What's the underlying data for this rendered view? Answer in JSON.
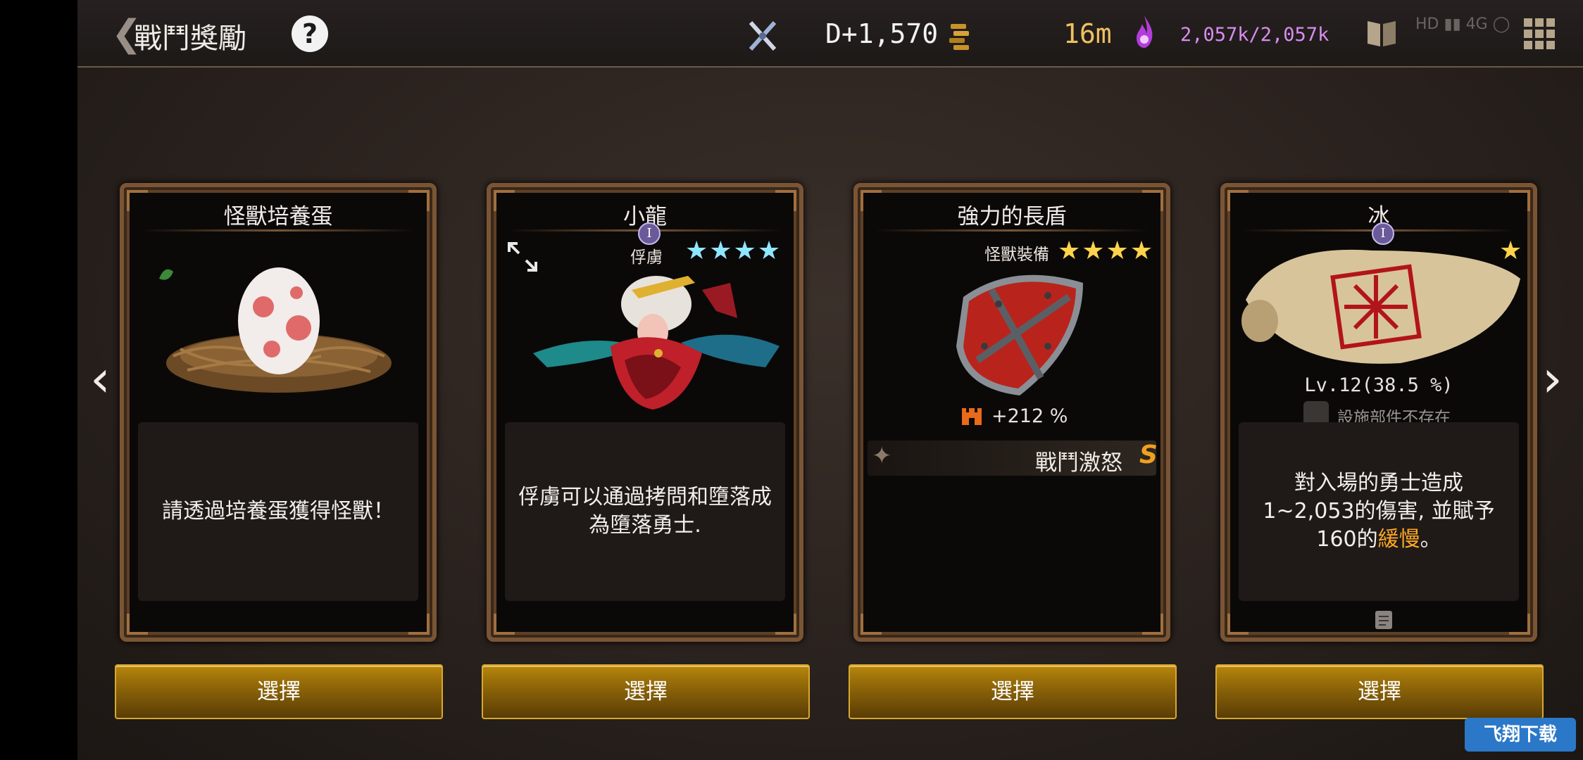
{
  "header": {
    "screen_title": "戰鬥獎勵",
    "help_label": "?",
    "day_counter": "D+1,570",
    "timer": "16m",
    "mana": "2,057k/2,057k"
  },
  "nav": {
    "prev_label": "‹",
    "next_label": "›"
  },
  "cards": [
    {
      "title": "怪獸培養蛋",
      "description": "請透過培養蛋獲得怪獸！",
      "select_label": "選擇"
    },
    {
      "title": "小龍",
      "rank": "I",
      "tag": "俘虜",
      "stars": "★★★★",
      "star_count": 4,
      "description": "俘虜可以通過拷問和墮落成為墮落勇士.",
      "select_label": "選擇"
    },
    {
      "title": "強力的長盾",
      "tag": "怪獸裝備",
      "stars": "★★★★",
      "star_count": 4,
      "stat": "+212 %",
      "skill_name": "戰鬥激怒",
      "skill_grade": "S",
      "select_label": "選擇"
    },
    {
      "title": "冰",
      "rank": "I",
      "stars": "★",
      "star_count": 1,
      "level": "Lv.12(38.5 %)",
      "facility_status": "設施部件不存在",
      "description_main": "對入場的勇士造成1~2,053的傷害, 並賦予160的",
      "description_highlight": "緩慢",
      "description_end": "。",
      "select_label": "選擇"
    }
  ],
  "watermark": "飞翔下载",
  "colors": {
    "gold_button": "#8a6208",
    "card_border": "#7a5535",
    "highlight_orange": "#ffa726",
    "mana_purple": "#d98cf0",
    "timer_gold": "#f0c060"
  }
}
